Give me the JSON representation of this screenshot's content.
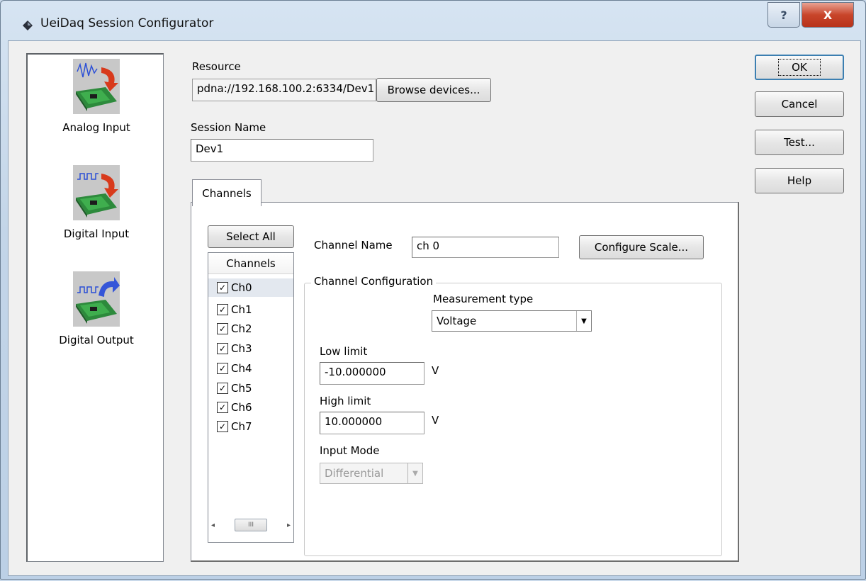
{
  "window": {
    "title": "UeiDaq Session Configurator",
    "help_glyph": "?",
    "close_glyph": "X"
  },
  "sidebar": {
    "items": [
      {
        "label": "Analog Input",
        "icon": "analog-input-icon"
      },
      {
        "label": "Digital Input",
        "icon": "digital-input-icon"
      },
      {
        "label": "Digital Output",
        "icon": "digital-output-icon"
      }
    ]
  },
  "resource": {
    "label": "Resource",
    "value": "pdna://192.168.100.2:6334/Dev1",
    "browse_label": "Browse devices..."
  },
  "session": {
    "label": "Session Name",
    "value": "Dev1"
  },
  "tabs": [
    {
      "label": "Channels"
    }
  ],
  "channels": {
    "select_all_label": "Select All",
    "list_header": "Channels",
    "items": [
      {
        "label": "Ch0",
        "checked": true
      },
      {
        "label": "Ch1",
        "checked": true
      },
      {
        "label": "Ch2",
        "checked": true
      },
      {
        "label": "Ch3",
        "checked": true
      },
      {
        "label": "Ch4",
        "checked": true
      },
      {
        "label": "Ch5",
        "checked": true
      },
      {
        "label": "Ch6",
        "checked": true
      },
      {
        "label": "Ch7",
        "checked": true
      }
    ],
    "check_glyph": "✓",
    "scroll_left_glyph": "◂",
    "scroll_right_glyph": "▸",
    "scroll_thumb_glyph": "III"
  },
  "channel": {
    "name_label": "Channel Name",
    "name_value": "ch 0",
    "configure_scale_label": "Configure Scale...",
    "group_title": "Channel Configuration",
    "measurement_type_label": "Measurement type",
    "measurement_type_value": "Voltage",
    "low_limit_label": "Low limit",
    "low_limit_value": "-10.000000",
    "high_limit_label": "High limit",
    "high_limit_value": "10.000000",
    "unit": "V",
    "input_mode_label": "Input Mode",
    "input_mode_value": "Differential",
    "dropdown_glyph": "▼"
  },
  "actions": {
    "ok": "OK",
    "cancel": "Cancel",
    "test": "Test...",
    "help": "Help"
  }
}
